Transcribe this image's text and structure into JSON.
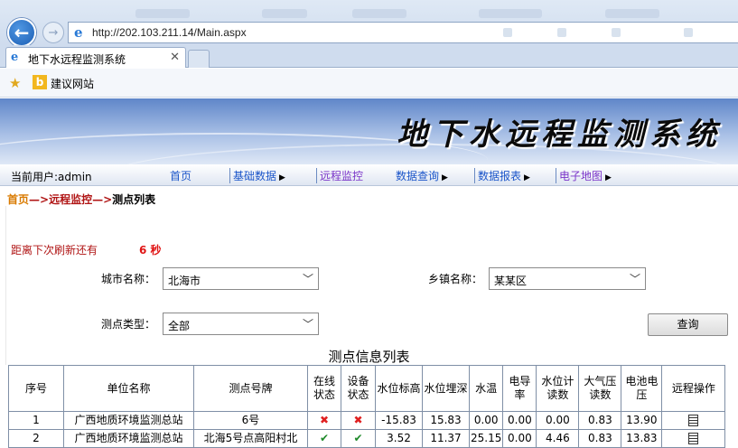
{
  "browser": {
    "url": "http://202.103.211.14/Main.aspx",
    "tab_title": "地下水远程监测系统",
    "favorites_label": "建议网站"
  },
  "page": {
    "banner_title": "地下水远程监测系统",
    "current_user": "当前用户:admin",
    "nav": [
      {
        "label": "首页"
      },
      {
        "label": "基础数据"
      },
      {
        "label": "远程监控"
      },
      {
        "label": "数据查询"
      },
      {
        "label": "数据报表"
      },
      {
        "label": "电子地图"
      }
    ],
    "breadcrumb": {
      "home": "首页",
      "sep": "—>",
      "middle": "远程监控",
      "current": "测点列表"
    },
    "refresh": {
      "label": "距离下次刷新还有",
      "count": "6 秒"
    },
    "filters": {
      "city_label": "城市名称：",
      "city_value": "北海市",
      "town_label": "乡镇名称：",
      "town_value": "某某区",
      "type_label": "测点类型：",
      "type_value": "全部",
      "query_button": "查询"
    },
    "table": {
      "title": "测点信息列表",
      "headers": [
        "序号",
        "单位名称",
        "测点号牌",
        "在线状态",
        "设备状态",
        "水位标高",
        "水位埋深",
        "水温",
        "电导率",
        "水位计读数",
        "大气压读数",
        "电池电压",
        "远程操作"
      ],
      "rows": [
        {
          "no": "1",
          "unit": "广西地质环境监测总站",
          "plate": "6号",
          "online": "✖",
          "device": "✖",
          "level": "-15.83",
          "depth": "15.83",
          "temp": "0.00",
          "cond": "0.00",
          "meter": "0.00",
          "pressure": "0.83",
          "battery": "13.90"
        },
        {
          "no": "2",
          "unit": "广西地质环境监测总站",
          "plate": "北海5号点高阳村北",
          "online": "✔",
          "device": "✔",
          "level": "3.52",
          "depth": "11.37",
          "temp": "25.15",
          "cond": "0.00",
          "meter": "4.46",
          "pressure": "0.83",
          "battery": "13.83"
        }
      ]
    }
  }
}
